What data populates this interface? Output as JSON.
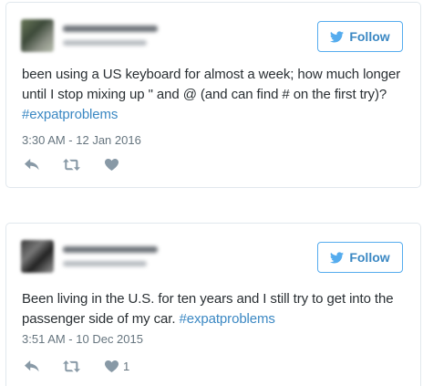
{
  "colors": {
    "link": "#3b88c3",
    "follow_border": "#55acee",
    "text": "#292f33",
    "meta": "#66757f",
    "icon": "#8899a6",
    "card_border": "#e1e8ed"
  },
  "tweets": [
    {
      "follow_label": "Follow",
      "text_before": "been using a US keyboard for almost a week; how much longer until I stop mixing up \" and @ (and can find # on the first try)? ",
      "hashtag": "#expatproblems",
      "text_after": "",
      "timestamp": "3:30 AM - 12 Jan 2016",
      "like_count": ""
    },
    {
      "follow_label": "Follow",
      "text_before": "Been living in the U.S. for ten years and I still try to get into the passenger side of my car. ",
      "hashtag": "#expatproblems",
      "text_after": "",
      "timestamp": "3:51 AM - 10 Dec 2015",
      "like_count": "1"
    }
  ],
  "icons": {
    "follow": "twitter-bird-icon",
    "reply": "reply-icon",
    "retweet": "retweet-icon",
    "like": "heart-icon"
  }
}
